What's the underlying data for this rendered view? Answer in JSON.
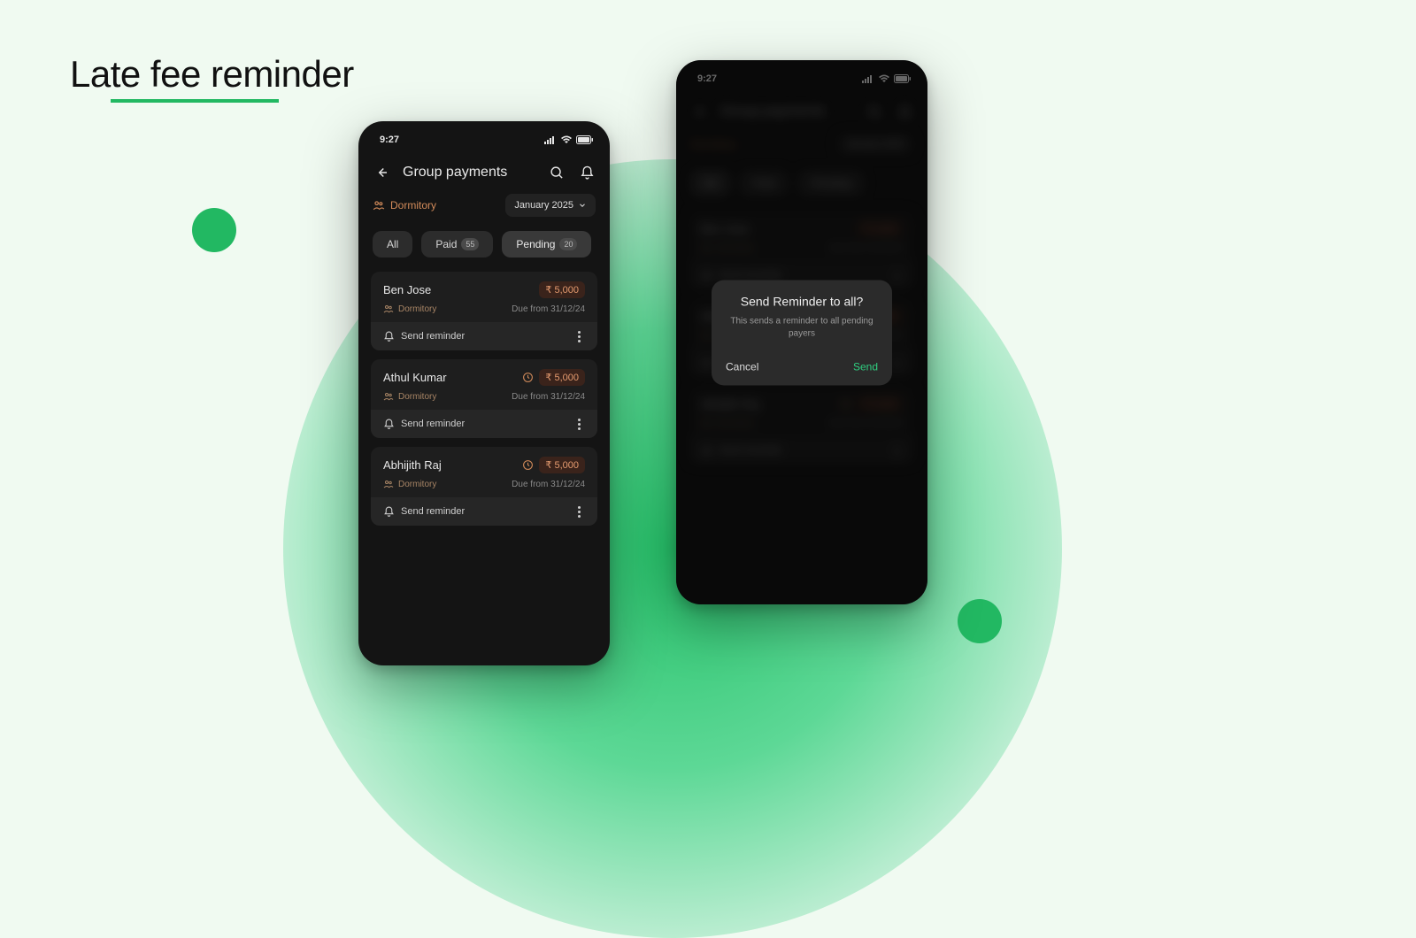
{
  "heading": "Late fee reminder",
  "status": {
    "time": "9:27"
  },
  "appbar": {
    "title": "Group payments"
  },
  "subheader": {
    "group": "Dormitory",
    "month": "January 2025"
  },
  "filters": {
    "all": "All",
    "paid_label": "Paid",
    "paid_count": "55",
    "pending_label": "Pending",
    "pending_count": "20"
  },
  "reminder_label": "Send reminder",
  "people": [
    {
      "name": "Ben Jose",
      "group": "Dormitory",
      "amount": "₹ 5,000",
      "due": "Due from 31/12/24",
      "has_clock": false
    },
    {
      "name": "Athul Kumar",
      "group": "Dormitory",
      "amount": "₹ 5,000",
      "due": "Due from 31/12/24",
      "has_clock": true
    },
    {
      "name": "Abhijith Raj",
      "group": "Dormitory",
      "amount": "₹ 5,000",
      "due": "Due from 31/12/24",
      "has_clock": true
    }
  ],
  "dialog": {
    "title": "Send Reminder to all?",
    "message": "This sends a reminder to all pending payers",
    "cancel": "Cancel",
    "send": "Send"
  }
}
